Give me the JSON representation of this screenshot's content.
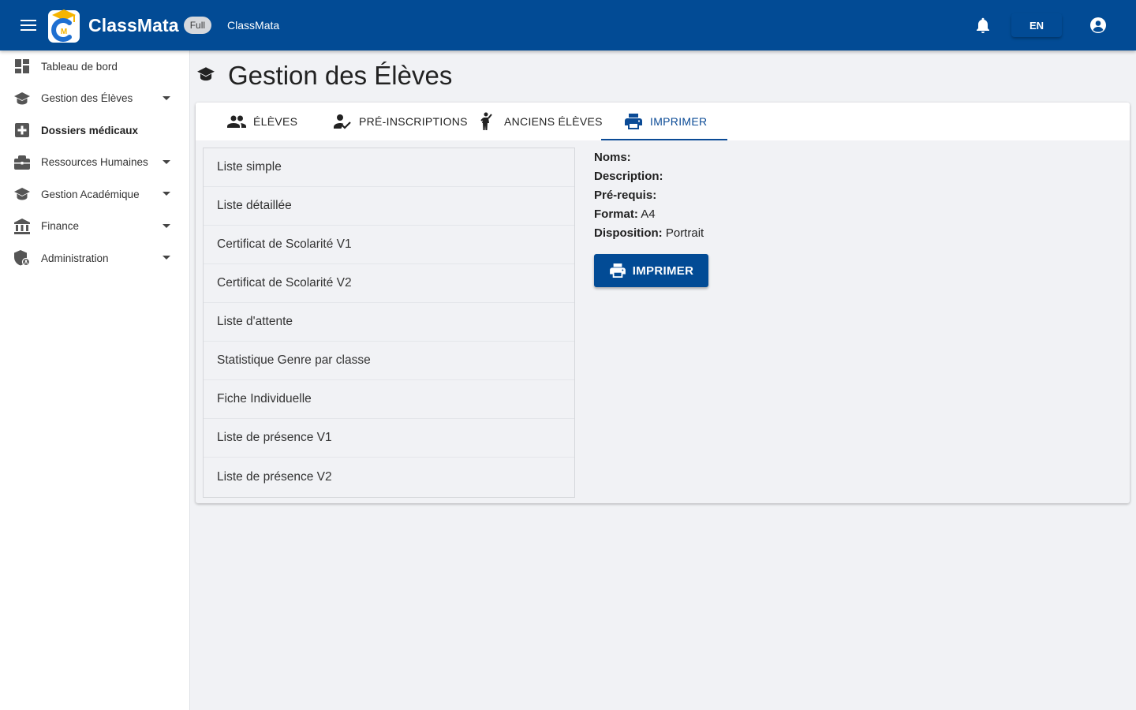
{
  "header": {
    "brand": "ClassMata",
    "badge": "Full",
    "app_name": "ClassMata",
    "lang_button": "EN",
    "icons": [
      "menu-icon",
      "bell-icon",
      "account-circle-icon"
    ]
  },
  "sidebar": {
    "items": [
      {
        "label": "Tableau de bord",
        "icon": "dashboard-icon",
        "expandable": false
      },
      {
        "label": "Gestion des Élèves",
        "icon": "graduation-cap-icon",
        "expandable": true
      },
      {
        "label": "Dossiers médicaux",
        "icon": "medical-plus-icon",
        "expandable": false,
        "bold": true
      },
      {
        "label": "Ressources Humaines",
        "icon": "briefcase-icon",
        "expandable": true
      },
      {
        "label": "Gestion Académique",
        "icon": "school-icon",
        "expandable": true
      },
      {
        "label": "Finance",
        "icon": "bank-icon",
        "expandable": true
      },
      {
        "label": "Administration",
        "icon": "admin-shield-icon",
        "expandable": true
      }
    ]
  },
  "page": {
    "title": "Gestion des Élèves",
    "title_icon": "graduation-cap-icon"
  },
  "tabs": [
    {
      "label": "ÉLÈVES",
      "icon": "people-icon"
    },
    {
      "label": "PRÉ-INSCRIPTIONS",
      "icon": "person-check-icon"
    },
    {
      "label": "ANCIENS ÉLÈVES",
      "icon": "person-wave-icon"
    },
    {
      "label": "IMPRIMER",
      "icon": "printer-icon",
      "active": true
    }
  ],
  "reports": [
    "Liste simple",
    "Liste détaillée",
    "Certificat de Scolarité V1",
    "Certificat de Scolarité V2",
    "Liste d'attente",
    "Statistique Genre par classe",
    "Fiche Individuelle",
    "Liste de présence V1",
    "Liste de présence V2"
  ],
  "details": {
    "names_label": "Noms:",
    "names_value": "",
    "description_label": "Description:",
    "description_value": "",
    "prereq_label": "Pré-requis:",
    "prereq_value": "",
    "format_label": "Format:",
    "format_value": "A4",
    "layout_label": "Disposition:",
    "layout_value": "Portrait"
  },
  "print_button": {
    "label": "IMPRIMER",
    "icon": "printer-icon"
  },
  "colors": {
    "primary": "#024b95",
    "background": "#f1f2f5",
    "accent_logo": "#f5b400"
  }
}
